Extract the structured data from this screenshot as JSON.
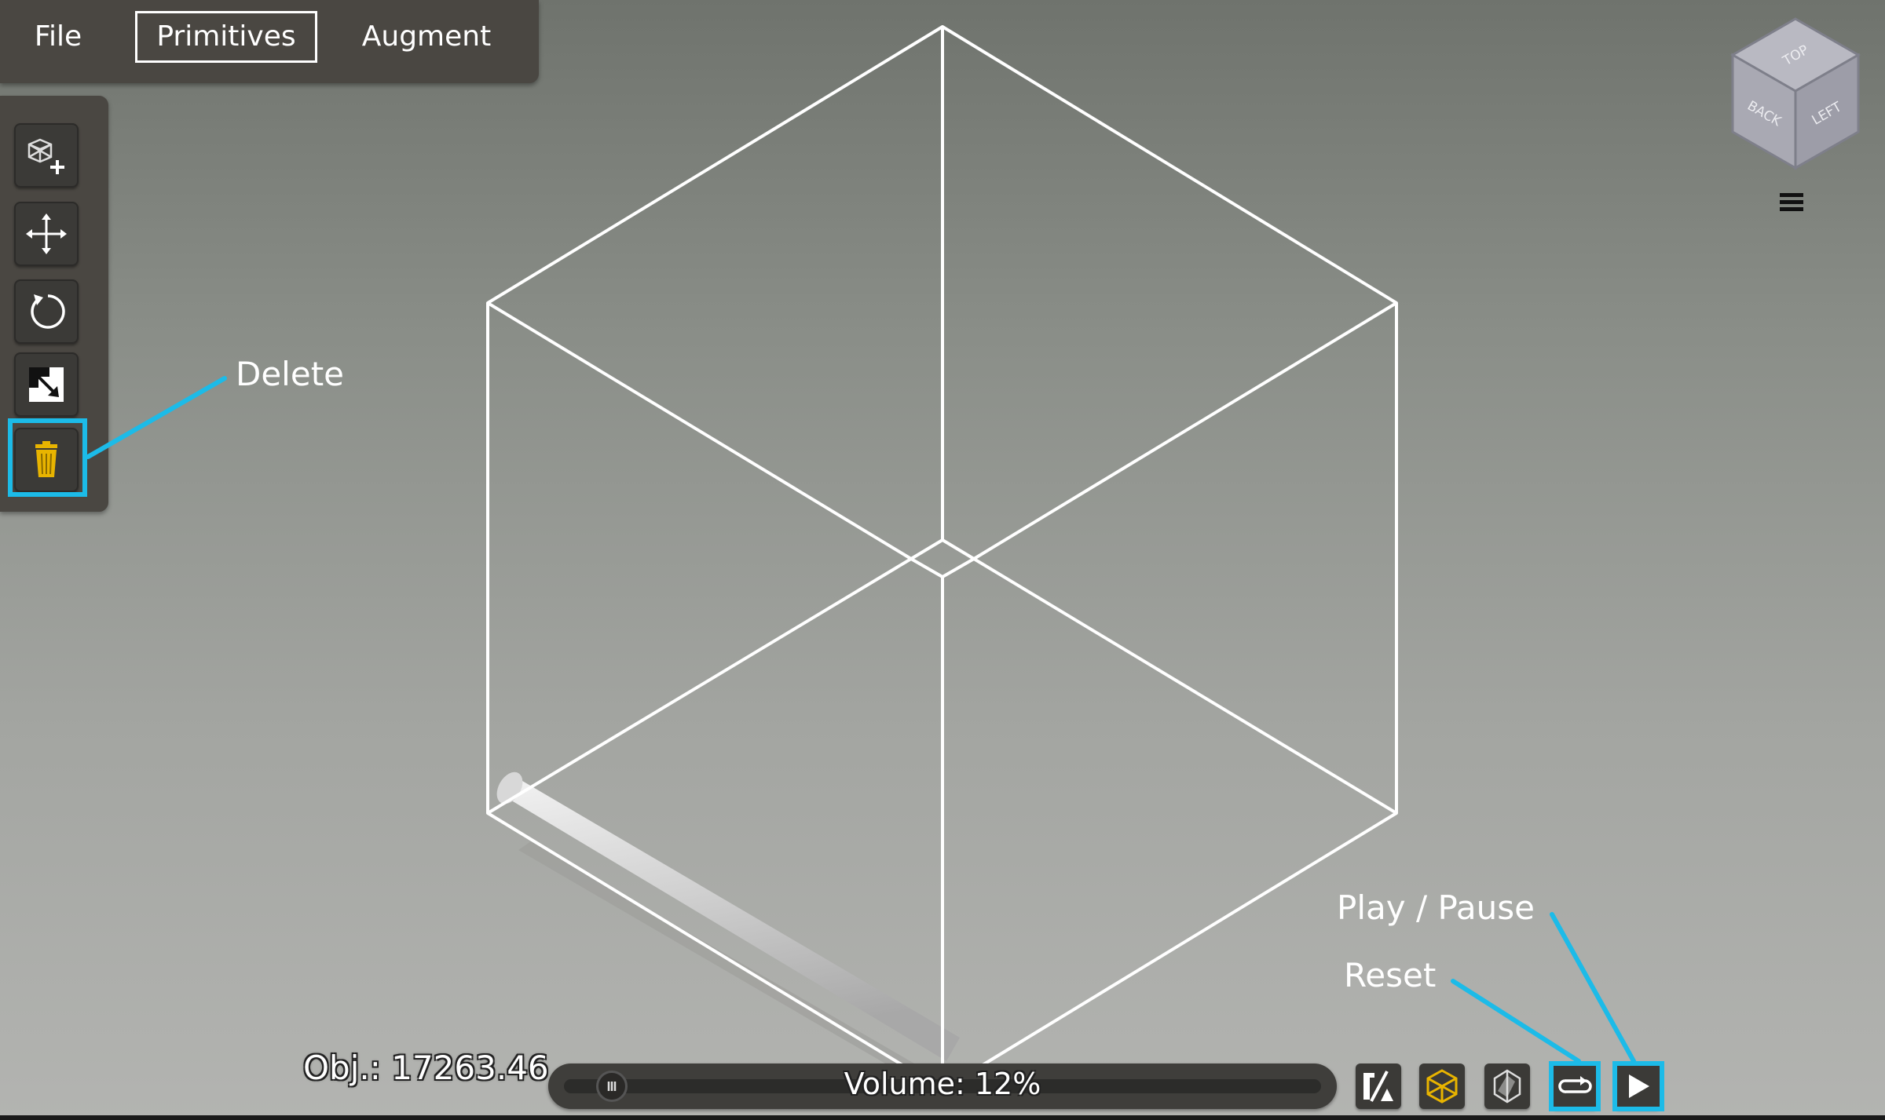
{
  "menu": {
    "file": "File",
    "primitives": "Primitives",
    "augment": "Augment"
  },
  "toolbar": {
    "tools": [
      {
        "name": "add-primitive",
        "icon": "cube-plus-icon"
      },
      {
        "name": "move",
        "icon": "move-arrows-icon"
      },
      {
        "name": "rotate",
        "icon": "rotate-icon"
      },
      {
        "name": "scale",
        "icon": "scale-icon"
      },
      {
        "name": "delete",
        "icon": "trash-icon",
        "color": "#e8b400"
      }
    ]
  },
  "annotations": {
    "delete": "Delete",
    "play_pause": "Play / Pause",
    "reset": "Reset",
    "color": "#1cbbe8"
  },
  "navcube": {
    "top": "TOP",
    "back": "BACK",
    "left": "LEFT"
  },
  "status": {
    "obj": "Obj.: 17263.46",
    "volume": "Volume: 12%",
    "volume_fraction": 0.04
  },
  "bottom_buttons": [
    {
      "name": "fraction",
      "icon": "fraction-icon"
    },
    {
      "name": "wireframe-cube",
      "icon": "wireframe-cube-icon",
      "color": "#e8b400"
    },
    {
      "name": "cut-plane",
      "icon": "cut-plane-icon"
    },
    {
      "name": "reset",
      "icon": "loop-icon"
    },
    {
      "name": "play",
      "icon": "play-icon"
    }
  ]
}
